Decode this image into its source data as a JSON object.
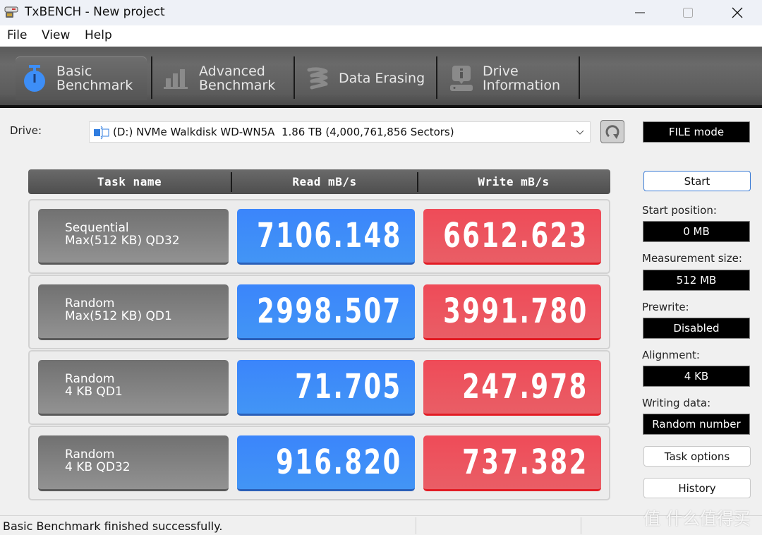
{
  "window": {
    "title": "TxBENCH - New project",
    "controls": {
      "minimize": "minimize",
      "maximize": "maximize",
      "close": "close"
    }
  },
  "menu": [
    "File",
    "View",
    "Help"
  ],
  "toolbar": {
    "tabs": [
      {
        "label_line1": "Basic",
        "label_line2": "Benchmark",
        "icon": "stopwatch-icon",
        "active": true
      },
      {
        "label_line1": "Advanced",
        "label_line2": "Benchmark",
        "icon": "bar-chart-icon",
        "active": false
      },
      {
        "label_line1": "Data Erasing",
        "label_line2": "",
        "icon": "spring-icon",
        "active": false
      },
      {
        "label_line1": "Drive",
        "label_line2": "Information",
        "icon": "drive-info-icon",
        "active": false
      }
    ]
  },
  "drive": {
    "label": "Drive:",
    "selected": "(D:) NVMe Walkdisk WD-WN5A  1.86 TB (4,000,761,856 Sectors)",
    "mode": "FILE mode"
  },
  "table": {
    "headers": [
      "Task name",
      "Read mB/s",
      "Write mB/s"
    ],
    "rows": [
      {
        "task_line1": "Sequential",
        "task_line2": "Max(512 KB) QD32",
        "read": "7106.148",
        "write": "6612.623"
      },
      {
        "task_line1": "Random",
        "task_line2": "Max(512 KB) QD1",
        "read": "2998.507",
        "write": "3991.780"
      },
      {
        "task_line1": "Random",
        "task_line2": "4 KB QD1",
        "read": "71.705",
        "write": "247.978"
      },
      {
        "task_line1": "Random",
        "task_line2": "4 KB QD32",
        "read": "916.820",
        "write": "737.382"
      }
    ]
  },
  "side": {
    "start_button": "Start",
    "start_position_label": "Start position:",
    "start_position": "0 MB",
    "measurement_size_label": "Measurement size:",
    "measurement_size": "512 MB",
    "prewrite_label": "Prewrite:",
    "prewrite": "Disabled",
    "alignment_label": "Alignment:",
    "alignment": "4 KB",
    "writing_data_label": "Writing data:",
    "writing_data": "Random number",
    "task_options_button": "Task options",
    "history_button": "History"
  },
  "status": {
    "message": "Basic Benchmark finished successfully."
  },
  "watermark": "值 什么值得买",
  "colors": {
    "read": "#3b85fb",
    "write": "#ef4b58",
    "accent": "#3a7bd5"
  }
}
